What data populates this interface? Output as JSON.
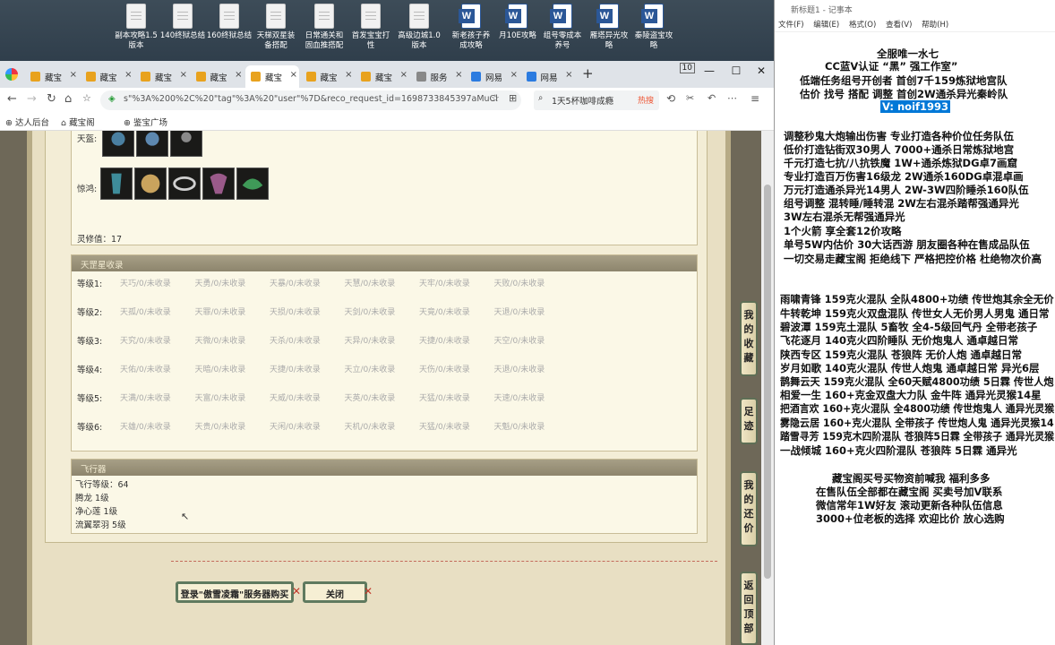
{
  "desktop_icons": [
    {
      "label": "副本攻略1.5\n版本",
      "type": "file"
    },
    {
      "label": "140终狱总结",
      "type": "file"
    },
    {
      "label": "160终狱总结",
      "type": "file"
    },
    {
      "label": "天梯双星装\n备搭配",
      "type": "file"
    },
    {
      "label": "日常通关和\n固血推搭配",
      "type": "file"
    },
    {
      "label": "首发宝宝打\n性",
      "type": "file"
    },
    {
      "label": "高级边城1.0\n版本",
      "type": "file"
    },
    {
      "label": "新老孩子养\n成攻略",
      "type": "word"
    },
    {
      "label": "月10E攻略",
      "type": "word"
    },
    {
      "label": "组号零成本\n养号",
      "type": "word"
    },
    {
      "label": "雁塔异光攻\n略",
      "type": "word"
    },
    {
      "label": "秦陵盗宝攻\n略",
      "type": "word"
    }
  ],
  "browser": {
    "tabs": [
      "藏宝",
      "藏宝",
      "藏宝",
      "藏宝",
      "藏宝",
      "藏宝",
      "藏宝",
      "服务",
      "网易",
      "网易"
    ],
    "active_tab": 4,
    "tab_count_badge": "10",
    "url": "s\"%3A%200%2C%20\"tag\"%3A%20\"user\"%7D&reco_request_id=1698733845397aMuCl",
    "search_text": "1天5杯咖啡成瘾",
    "search_badge": "热搜",
    "bookmarks": [
      "达人后台",
      "藏宝阁",
      "鉴宝广场"
    ]
  },
  "game": {
    "top_row_label": "天盔:",
    "jingyong_label": "惊鸿:",
    "lingxiu": "灵修值：17",
    "tianli_header": "天罡星收录",
    "levels": [
      {
        "label": "等级1:",
        "slots": [
          "天巧/0/未收录",
          "天勇/0/未收录",
          "天暴/0/未收录",
          "天慧/0/未收录",
          "天牢/0/未收录",
          "天败/0/未收录"
        ]
      },
      {
        "label": "等级2:",
        "slots": [
          "天孤/0/未收录",
          "天罪/0/未收录",
          "天损/0/未收录",
          "天剑/0/未收录",
          "天竟/0/未收录",
          "天退/0/未收录"
        ]
      },
      {
        "label": "等级3:",
        "slots": [
          "天究/0/未收录",
          "天微/0/未收录",
          "天杀/0/未收录",
          "天异/0/未收录",
          "天捷/0/未收录",
          "天空/0/未收录"
        ]
      },
      {
        "label": "等级4:",
        "slots": [
          "天佑/0/未收录",
          "天暗/0/未收录",
          "天捷/0/未收录",
          "天立/0/未收录",
          "天伤/0/未收录",
          "天退/0/未收录"
        ]
      },
      {
        "label": "等级5:",
        "slots": [
          "天满/0/未收录",
          "天富/0/未收录",
          "天威/0/未收录",
          "天英/0/未收录",
          "天猛/0/未收录",
          "天速/0/未收录"
        ]
      },
      {
        "label": "等级6:",
        "slots": [
          "天雄/0/未收录",
          "天贵/0/未收录",
          "天闲/0/未收录",
          "天机/0/未收录",
          "天猛/0/未收录",
          "天魁/0/未收录"
        ]
      }
    ],
    "fly_header": "飞行器",
    "fly_rows": [
      "飞行等级：64",
      "腾龙   1级",
      "净心莲   1级",
      "流翼翠羽   5级"
    ],
    "login_button": "登录\"傲雪凌霜\"服务器购买",
    "close_button": "关闭",
    "side_buttons": [
      "我的收藏",
      "足迹",
      "我的还价",
      "返回顶部"
    ]
  },
  "notepad": {
    "title": "新标题1 - 记事本",
    "menu": [
      "文件(F)",
      "编辑(E)",
      "格式(O)",
      "查看(V)",
      "帮助(H)"
    ],
    "lines": [
      "全服唯一水七",
      "CC蓝V认证 “黑” 强工作室”",
      "低端任务组号开创者          首创7千159炼狱地宫队",
      "估价 找号 搭配 调整          首创2W通杀异光秦岭队",
      "V:  noif1993",
      "调整秒鬼大炮输出伤害          专业打造各种价位任务队伍",
      "低价打造钻街双30男人          7000+通杀日常炼狱地宫",
      "千元打造七抗/八抗铁魔          1W+通杀炼狱DG卓7画窟",
      "专业打造百万伤害16级龙          2W通杀160DG卓混卓画",
      "万元打造通杀异光14男人          2W-3W四阶睡杀160队伍",
      "组号调整 混转睡/睡转混          2W左右混杀踏帮强通异光",
      "                                          3W左右混杀无帮强通异光",
      "1个火箭 享全套12价攻略",
      "单号5W内估价 30大话西游          朋友圈各种在售成品队伍",
      "一切交易走藏宝阁 拒绝线下     严格把控价格 杜绝物次价高",
      "雨啸青锋 159克火混队 全队4800+功绩 传世炮其余全无价",
      "牛转乾坤 159克火双盘混队 传世女人无价男人男鬼 通日常",
      "碧波潭     159克土混队 5畜牧 全4-5级回气丹 全带老孩子",
      "飞花逐月 140克火四阶睡队 无价炮鬼人 通卓越日常",
      "陕西专区 159克火混队 苍狼阵 无价人炮 通卓越日常",
      "岁月如歌 140克火混队 传世人炮鬼 通卓越日常 异光6层",
      "鹊舞云天 159克火混队 全60天赋4800功绩 5日霖 传世人炮",
      "相爱一生 160+克金双盘大力队 金牛阵 通异光灵猴14星",
      "把酒言欢 160+克火混队 全4800功绩 传世炮鬼人 通异光灵猴",
      "雾隐云居 160+克火混队 全带孩子 传世炮人鬼 通异光灵猴14",
      "踏雪寻芳 159克木四阶混队 苍狼阵5日霖 全带孩子 通异光灵猴",
      "一战倾城 160+克火四阶混队 苍狼阵 5日霖 通异光",
      "藏宝阁买号买物资前喊我 福利多多",
      "在售队伍全部都在藏宝阁 买卖号加V联系",
      "微信常年1W好友 滚动更新各种队伍信息",
      "3000+位老板的选择 欢迎比价 放心选购"
    ]
  }
}
